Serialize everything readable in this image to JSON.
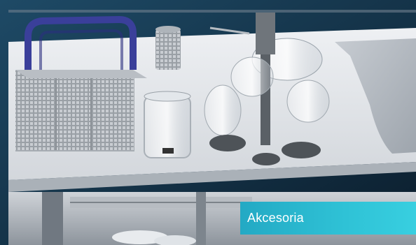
{
  "banner": {
    "label": "Akcesoria",
    "accent_color": "#2fc2d6"
  },
  "photo": {
    "subject_icons": [
      "cutlery-basket-icon",
      "bottle-holder-icon",
      "glass-holder-icon",
      "dishwasher-rack-icon"
    ]
  }
}
